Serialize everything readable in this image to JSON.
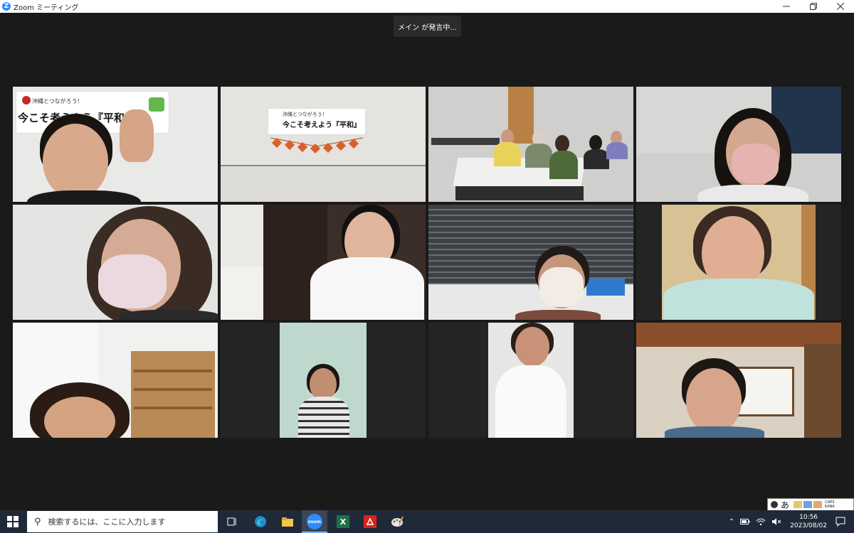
{
  "window": {
    "title": "Zoom ミーティング",
    "logo_letter": "Z"
  },
  "speaker_label": "メイン が発言中...",
  "banners": {
    "tile1_top": "沖縄とつながろう！",
    "tile1_main": "今こそ考えよう『平和』",
    "tile2_top": "沖縄とつながろう！",
    "tile2_main": "今こそ考えよう『平和』"
  },
  "taskbar": {
    "search_placeholder": "検索するには、ここに入力します",
    "apps": [
      "task-view",
      "edge",
      "file-explorer",
      "zoom",
      "excel",
      "acrobat",
      "paint"
    ],
    "zoom_label": "zoom",
    "excel_label": "X"
  },
  "tray": {
    "time": "10:56",
    "date": "2023/08/02"
  },
  "ime": {
    "mode": "あ",
    "caps": "CAPS",
    "kana": "KANA"
  },
  "colors": {
    "titlebar": "#ffffff",
    "background": "#1a1a1a",
    "taskbar": "#1f2a38",
    "zoom_blue": "#2d8cff"
  }
}
